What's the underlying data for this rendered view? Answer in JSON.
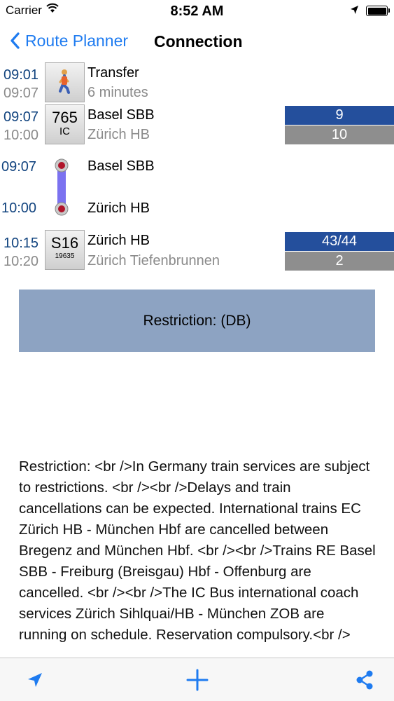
{
  "status_bar": {
    "carrier": "Carrier",
    "time": "8:52 AM"
  },
  "nav": {
    "back_label": "Route Planner",
    "title": "Connection"
  },
  "segments": [
    {
      "dep_time": "09:01",
      "arr_time": "09:07",
      "title": "Transfer",
      "subtitle": "6 minutes"
    },
    {
      "dep_time": "09:07",
      "arr_time": "10:00",
      "line_number": "765",
      "line_type": "IC",
      "from": "Basel SBB",
      "to": "Zürich HB",
      "dep_platform": "9",
      "arr_platform": "10"
    },
    {
      "dep_time": "09:07",
      "arr_time": "10:00",
      "from": "Basel SBB",
      "to": "Zürich HB"
    },
    {
      "dep_time": "10:15",
      "arr_time": "10:20",
      "line_number": "S16",
      "train_number": "19635",
      "from": "Zürich HB",
      "to": "Zürich Tiefenbrunnen",
      "dep_platform": "43/44",
      "arr_platform": "2"
    }
  ],
  "restriction": {
    "button_label": "Restriction: (DB)",
    "text": "Restriction: <br />In Germany train services are subject to restrictions. <br /><br />Delays and train cancellations can be expected. International trains EC Zürich HB - München Hbf are cancelled between Bregenz and München Hbf. <br /><br />Trains RE Basel SBB - Freiburg (Breisgau) Hbf - Offenburg are cancelled. <br /><br />The IC Bus international coach services Zürich Sihlquai/HB - München ZOB are running on schedule. Reservation compulsory.<br />"
  },
  "colors": {
    "accent": "#1e7bf0",
    "dep_time": "#12447f",
    "platform_dep": "#244f9c",
    "platform_arr": "#8e8e8e",
    "restriction_bg": "#8da3c2",
    "route_line": "#7b72f0"
  },
  "icons": {
    "tab_left": "location-arrow-icon",
    "tab_center": "plus-icon",
    "tab_right": "share-icon"
  }
}
